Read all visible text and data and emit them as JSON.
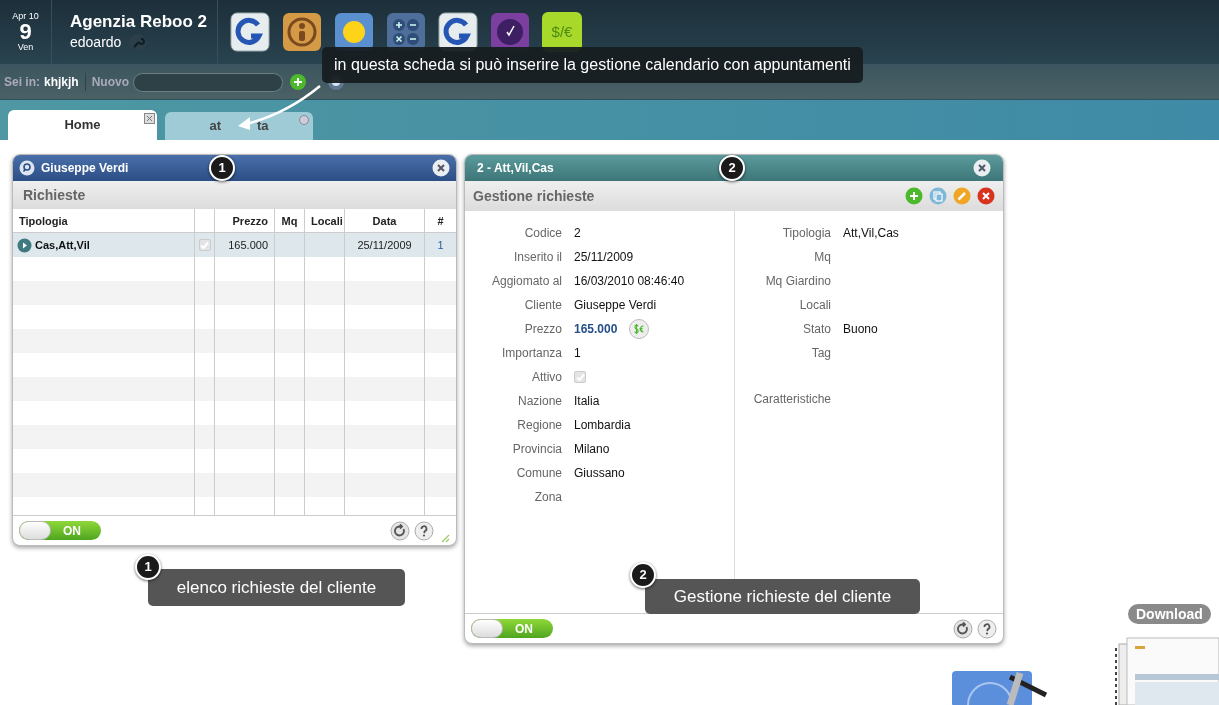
{
  "header": {
    "date": {
      "month_day": "Apr 10",
      "day": "9",
      "weekday": "Ven"
    },
    "title": "Agenzia Reboo 2",
    "user": "edoardo",
    "apps": [
      {
        "kind": "google"
      },
      {
        "kind": "contacts"
      },
      {
        "kind": "weather"
      },
      {
        "kind": "calculator"
      },
      {
        "kind": "google"
      },
      {
        "kind": "clock"
      },
      {
        "kind": "currency",
        "label": "$/€"
      }
    ]
  },
  "toolbar": {
    "location_label": "Sei in:",
    "location": "khjkjh",
    "new_label": "Nuovo"
  },
  "tabs": [
    {
      "label_parts": [
        "Home"
      ],
      "selected": true
    },
    {
      "label_parts": [
        "at",
        "ta"
      ],
      "selected": false
    }
  ],
  "list_panel": {
    "title": "Giuseppe Verdi",
    "subtitle": "Richieste",
    "columns": [
      "Tipologia",
      "",
      "Prezzo",
      "Mq",
      "Locali",
      "Data",
      "#"
    ],
    "rows": [
      {
        "selected": true,
        "tipologia": "Cas,Att,Vil",
        "checked": true,
        "prezzo": "165.000",
        "data": "25/11/2009",
        "count": "1"
      }
    ],
    "switch": {
      "on": true,
      "label": "ON"
    }
  },
  "detail_panel": {
    "title": "2 - Att,Vil,Cas",
    "subtitle": "Gestione richieste",
    "left_fields": [
      {
        "kind": "text",
        "label": "Codice",
        "value": "2"
      },
      {
        "kind": "text",
        "label": "Inserito il",
        "value": "25/11/2009"
      },
      {
        "kind": "text",
        "label": "Aggiomato al",
        "value": "16/03/2010 08:46:40"
      },
      {
        "kind": "text",
        "label": "Cliente",
        "value": "Giuseppe Verdi"
      },
      {
        "kind": "price",
        "label": "Prezzo",
        "value": "165.000"
      },
      {
        "kind": "text",
        "label": "Importanza",
        "value": "1"
      },
      {
        "kind": "checkbox",
        "label": "Attivo",
        "checked": true
      },
      {
        "kind": "text",
        "label": "Nazione",
        "value": "Italia"
      },
      {
        "kind": "text",
        "label": "Regione",
        "value": "Lombardia"
      },
      {
        "kind": "text",
        "label": "Provincia",
        "value": "Milano"
      },
      {
        "kind": "text",
        "label": "Comune",
        "value": "Giussano"
      },
      {
        "kind": "text",
        "label": "Zona"
      }
    ],
    "right_fields": [
      {
        "kind": "text",
        "label": "Tipologia",
        "value": "Att,Vil,Cas"
      },
      {
        "kind": "text",
        "label": "Mq"
      },
      {
        "kind": "text",
        "label": "Mq Giardino"
      },
      {
        "kind": "text",
        "label": "Locali"
      },
      {
        "kind": "text",
        "label": "Stato",
        "value": "Buono"
      },
      {
        "kind": "text",
        "label": "Tag"
      },
      {
        "kind": "multiline",
        "label": "Caratteristiche"
      }
    ],
    "switch": {
      "on": true,
      "label": "ON"
    }
  },
  "annotations": {
    "tab_tip": "in questa scheda si può inserire la gestione calendario con appuntamenti",
    "callouts": [
      {
        "panel_number": "1",
        "number": "1",
        "text": "elenco richieste del cliente"
      },
      {
        "panel_number": "2",
        "number": "2",
        "text": "Gestione richieste del cliente"
      }
    ]
  },
  "dock": {
    "download_label": "Download"
  }
}
